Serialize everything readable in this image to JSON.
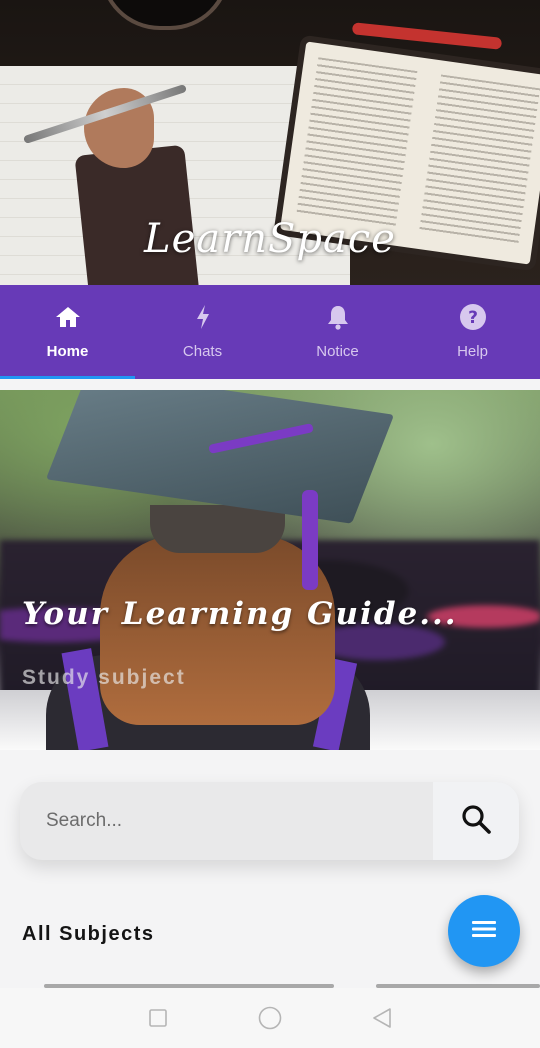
{
  "app": {
    "brand": "LearnSpace"
  },
  "tabs": [
    {
      "label": "Home",
      "icon": "home-icon",
      "active": true
    },
    {
      "label": "Chats",
      "icon": "bolt-icon",
      "active": false
    },
    {
      "label": "Notice",
      "icon": "bell-icon",
      "active": false
    },
    {
      "label": "Help",
      "icon": "help-icon",
      "active": false
    }
  ],
  "banner": {
    "title": "Your Learning Guide...",
    "subtitle": "Study subject"
  },
  "search": {
    "placeholder": "Search...",
    "value": ""
  },
  "section": {
    "title": "All Subjects"
  },
  "colors": {
    "tab_bar": "#673ab7",
    "active_indicator": "#2196f3",
    "fab": "#2196f3"
  }
}
